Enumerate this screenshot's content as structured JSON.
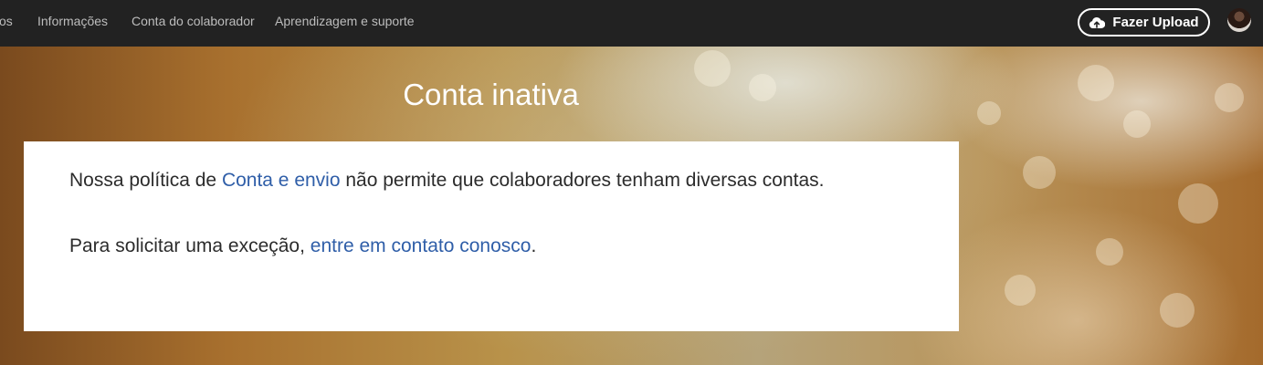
{
  "nav": {
    "items": [
      {
        "label": "os"
      },
      {
        "label": "Informações"
      },
      {
        "label": "Conta do colaborador"
      },
      {
        "label": "Aprendizagem e suporte"
      }
    ],
    "upload_label": "Fazer Upload"
  },
  "hero": {
    "title": "Conta inativa"
  },
  "message": {
    "line1_before": "Nossa política de ",
    "line1_link": "Conta e envio",
    "line1_after": " não permite que colaboradores tenham diversas contas.",
    "line2_before": "Para solicitar uma exceção, ",
    "line2_link": "entre em contato conosco",
    "line2_after": "."
  },
  "colors": {
    "topbar": "#222222",
    "link": "#2f5ea8",
    "text": "#2c2c2c"
  },
  "icons": {
    "upload": "cloud-upload-icon",
    "avatar": "user-avatar"
  }
}
